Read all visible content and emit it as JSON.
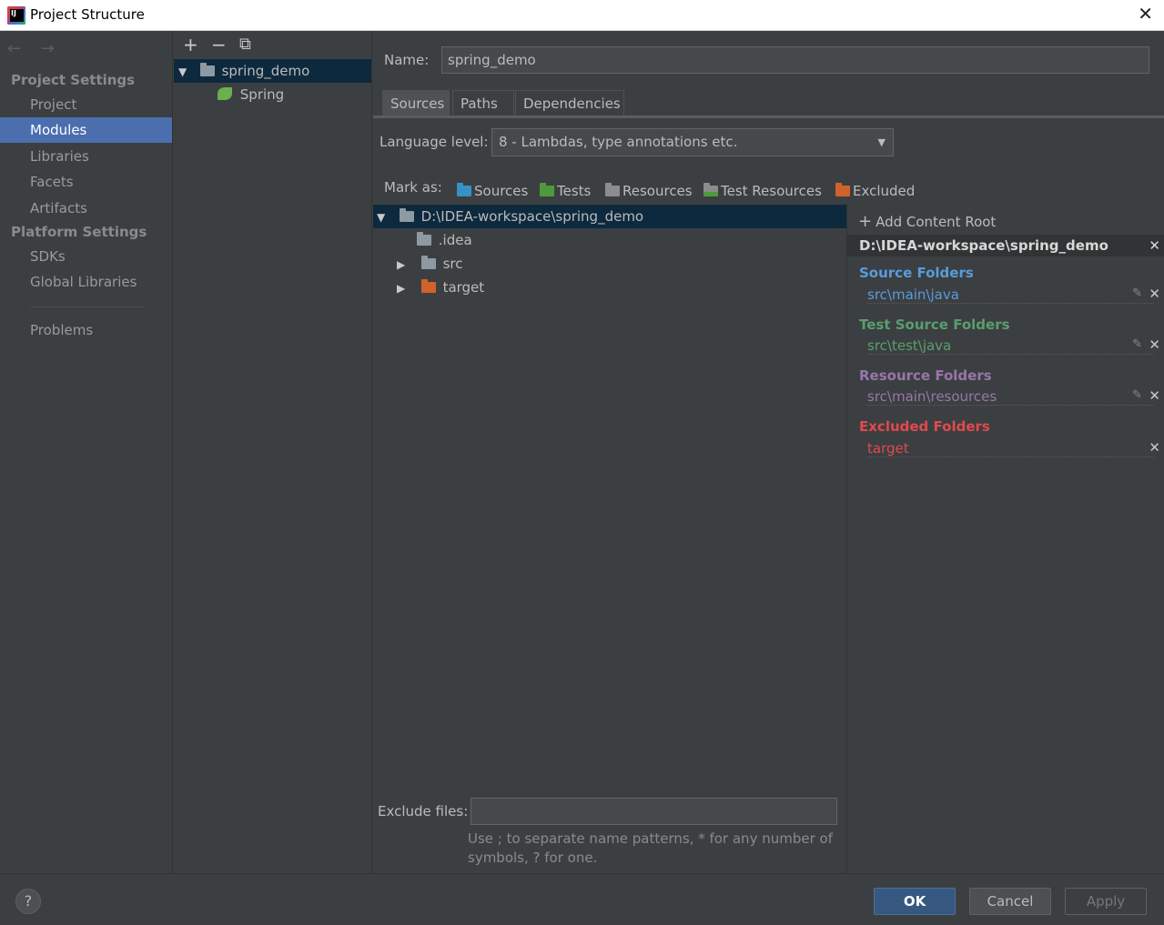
{
  "window": {
    "title": "Project Structure",
    "close": "✕"
  },
  "nav": {
    "arrows": "← →",
    "project_settings": "Project Settings",
    "platform_settings": "Platform Settings",
    "items": [
      "Project",
      "Modules",
      "Libraries",
      "Facets",
      "Artifacts"
    ],
    "platform_items": [
      "SDKs",
      "Global Libraries"
    ],
    "problems": "Problems",
    "selected": "Modules"
  },
  "modules": {
    "toolbar": {
      "add": "+",
      "remove": "−",
      "copy": "⧉"
    },
    "root": "spring_demo",
    "child": "Spring"
  },
  "module": {
    "name_label": "Name:",
    "name_value": "spring_demo",
    "tabs": [
      "Sources",
      "Paths",
      "Dependencies"
    ],
    "active_tab": "Sources",
    "language_label": "Language level:",
    "language_value": "8 - Lambdas, type annotations etc.",
    "mark_as_label": "Mark as:",
    "mark_as": [
      "Sources",
      "Tests",
      "Resources",
      "Test Resources",
      "Excluded"
    ],
    "tree": {
      "root": "D:\\IDEA-workspace\\spring_demo",
      "children": [
        ".idea",
        "src",
        "target"
      ]
    },
    "exclude_label": "Exclude files:",
    "exclude_value": "",
    "hint_line1": "Use ; to separate name patterns, * for any number of",
    "hint_line2": "symbols, ? for one."
  },
  "content_root": {
    "add_label": "Add Content Root",
    "path": "D:\\IDEA-workspace\\spring_demo",
    "sections": [
      {
        "title": "Source Folders",
        "entry": "src\\main\\java",
        "color": "#5a9bdc"
      },
      {
        "title": "Test Source Folders",
        "entry": "src\\test\\java",
        "color": "#5a9e6f"
      },
      {
        "title": "Resource Folders",
        "entry": "src\\main\\resources",
        "color": "#9876aa"
      },
      {
        "title": "Excluded Folders",
        "entry": "target",
        "color": "#e0494f"
      }
    ]
  },
  "buttons": {
    "help": "?",
    "ok": "OK",
    "cancel": "Cancel",
    "apply": "Apply"
  },
  "colors": {
    "source_folder": "#3592c4",
    "test_folder": "#4e9a3a",
    "resource_folder": "#8c8c8c",
    "excluded_folder": "#d0622a",
    "plain_folder": "#8d9aa3"
  }
}
